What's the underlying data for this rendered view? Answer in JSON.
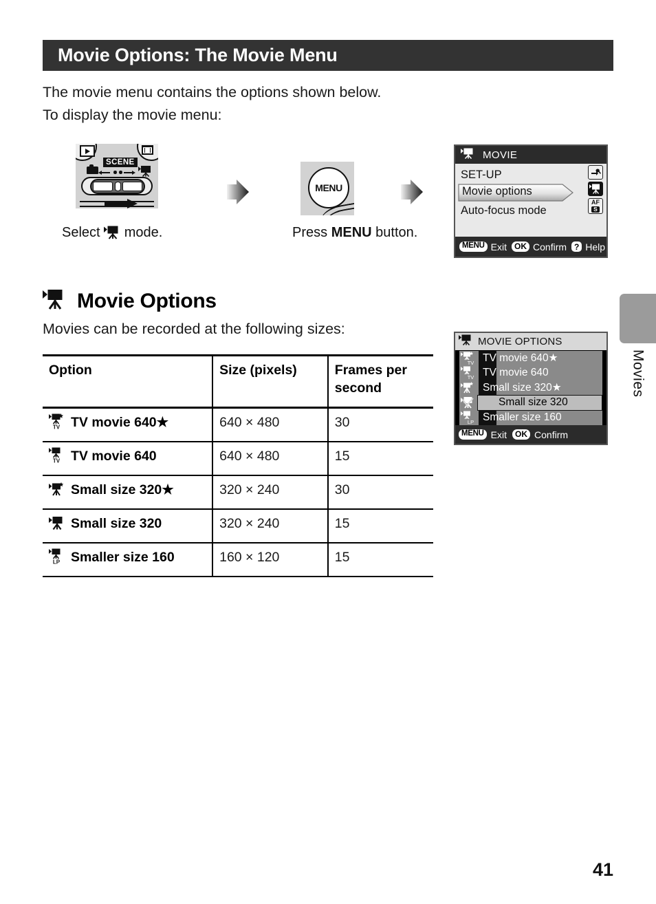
{
  "header": {
    "title": "Movie Options: The Movie Menu",
    "bar_color": "#333333"
  },
  "intro": {
    "line1": "The movie menu contains the options shown below.",
    "line2": "To display the movie menu:"
  },
  "steps": [
    {
      "caption_before": "Select ",
      "caption_after": " mode.",
      "icon": "movie-mode-icon",
      "art": "mode-dial-art",
      "scene_label": "SCENE"
    },
    {
      "caption_before": "Press ",
      "caption_bold": "MENU",
      "caption_after": " button.",
      "art": "menu-button-art",
      "button_label": "MENU"
    }
  ],
  "section": {
    "heading": "Movie Options",
    "subtext": "Movies can be recorded at the following sizes:",
    "icon": "movie-camera-icon"
  },
  "table": {
    "headers": [
      "Option",
      "Size (pixels)",
      "Frames per second"
    ],
    "rows": [
      {
        "icon": "movie-tv-star-icon",
        "option": "TV movie 640★",
        "size": "640 × 480",
        "fps": "30"
      },
      {
        "icon": "movie-tv-icon",
        "option": "TV movie 640",
        "size": "640 × 480",
        "fps": "15"
      },
      {
        "icon": "movie-small-star-icon",
        "option": "Small size 320★",
        "size": "320 × 240",
        "fps": "30"
      },
      {
        "icon": "movie-small-icon",
        "option": "Small size 320",
        "size": "320 × 240",
        "fps": "15"
      },
      {
        "icon": "movie-lp-icon",
        "option": "Smaller size 160",
        "size": "160 × 120",
        "fps": "15"
      }
    ]
  },
  "lcd_movie_menu": {
    "title": "MOVIE",
    "title_icon": "movie-mode-icon",
    "items": [
      {
        "label": "SET-UP",
        "icon": "setup-wrench-icon",
        "highlighted": false
      },
      {
        "label": "Movie options",
        "icon": "movie-camera-icon",
        "highlighted": true
      },
      {
        "label": "Auto-focus mode",
        "icon": "af-s-icon",
        "highlighted": false
      }
    ],
    "footer": [
      {
        "badge": "MENU",
        "label": "Exit"
      },
      {
        "badge": "OK",
        "label": "Confirm"
      },
      {
        "badge": "?",
        "label": "Help"
      }
    ]
  },
  "lcd_movie_options": {
    "title": "MOVIE OPTIONS",
    "title_icon": "movie-mode-icon",
    "items": [
      {
        "label": "TV movie 640★",
        "icon": "movie-tv-star-icon",
        "selected": false,
        "checked": false
      },
      {
        "label": "TV movie 640",
        "icon": "movie-tv-icon",
        "selected": false,
        "checked": false
      },
      {
        "label": "Small size 320★",
        "icon": "movie-small-star-icon",
        "selected": false,
        "checked": false
      },
      {
        "label": "Small size 320",
        "icon": "movie-small-icon",
        "selected": true,
        "checked": true
      },
      {
        "label": "Smaller size 160",
        "icon": "movie-lp-icon",
        "selected": false,
        "checked": false
      }
    ],
    "footer": [
      {
        "badge": "MENU",
        "label": "Exit"
      },
      {
        "badge": "OK",
        "label": "Confirm"
      }
    ]
  },
  "side_tab": {
    "label": "Movies",
    "color": "#9b9b9b"
  },
  "page_number": "41"
}
